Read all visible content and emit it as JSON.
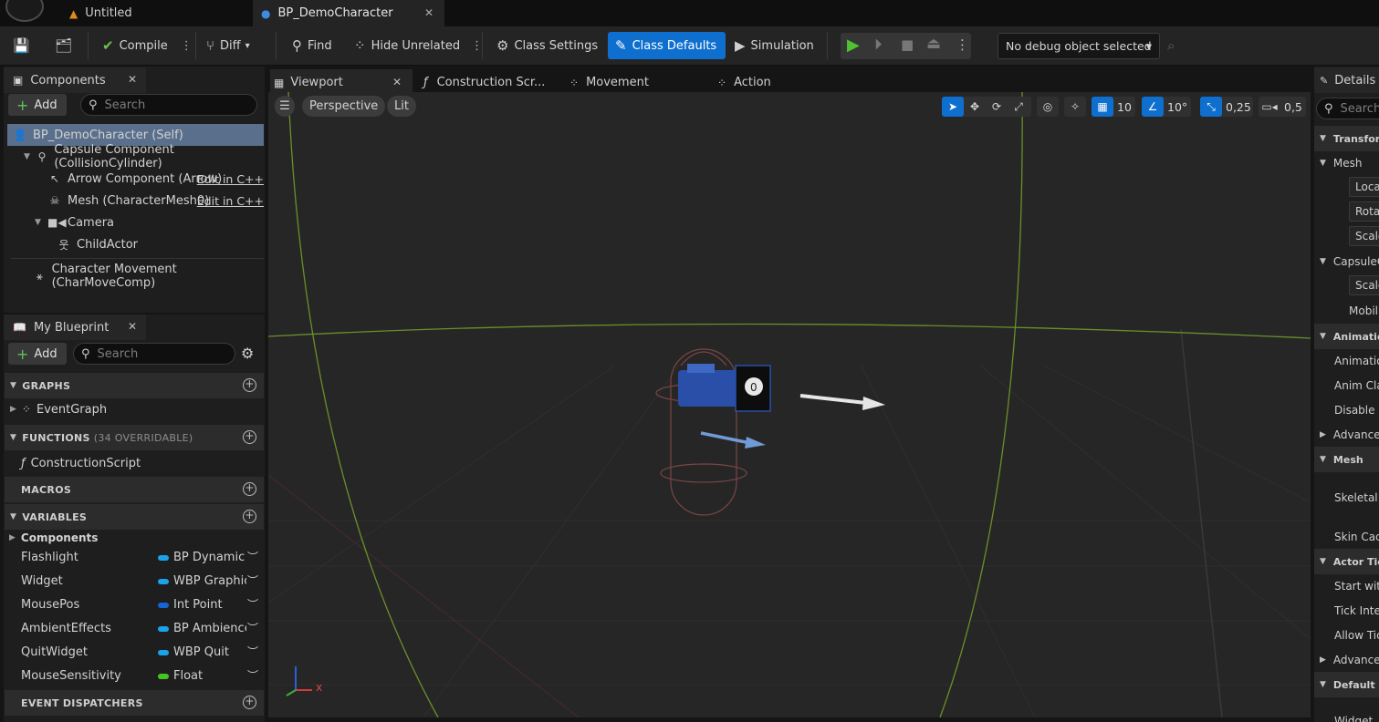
{
  "tabs": {
    "untitled": "Untitled",
    "blueprint": "BP_DemoCharacter"
  },
  "toolbar": {
    "compile": "Compile",
    "diff": "Diff",
    "find": "Find",
    "hide_unrelated": "Hide Unrelated",
    "class_settings": "Class Settings",
    "class_defaults": "Class Defaults",
    "simulation": "Simulation",
    "debug_object": "No debug object selected"
  },
  "components_panel": {
    "title": "Components",
    "add": "Add",
    "search_placeholder": "Search",
    "edit_cpp": "Edit in C++",
    "items": [
      "BP_DemoCharacter (Self)",
      "Capsule Component (CollisionCylinder)",
      "Arrow Component (Arrow)",
      "Mesh (CharacterMesh0)",
      "Camera",
      "ChildActor",
      "Character Movement (CharMoveComp)"
    ]
  },
  "my_blueprint": {
    "title": "My Blueprint",
    "add": "Add",
    "search_placeholder": "Search",
    "graphs_header": "GRAPHS",
    "event_graph": "EventGraph",
    "functions_header": "FUNCTIONS",
    "functions_overridable": "(34 OVERRIDABLE)",
    "construction_script": "ConstructionScript",
    "macros_header": "MACROS",
    "variables_header": "VARIABLES",
    "components_category": "Components",
    "variables": [
      {
        "name": "Flashlight",
        "type": "BP Dynamic",
        "color": "#1aa3e8"
      },
      {
        "name": "Widget",
        "type": "WBP Graphic",
        "color": "#1aa3e8"
      },
      {
        "name": "MousePos",
        "type": "Int Point",
        "color": "#1565d8"
      },
      {
        "name": "AmbientEffects",
        "type": "BP Ambience",
        "color": "#1aa3e8"
      },
      {
        "name": "QuitWidget",
        "type": "WBP Quit",
        "color": "#1aa3e8"
      },
      {
        "name": "MouseSensitivity",
        "type": "Float",
        "color": "#43c61d"
      }
    ],
    "event_dispatchers_header": "EVENT DISPATCHERS"
  },
  "viewport": {
    "tabs": [
      "Viewport",
      "Construction Scr...",
      "Movement",
      "Action"
    ],
    "perspective": "Perspective",
    "lit": "Lit",
    "grid_snap": "10",
    "rotation_snap": "10°",
    "scale_snap": "0,25",
    "camera_speed": "0,5",
    "axis_x": "x"
  },
  "details": {
    "title": "Details",
    "search_placeholder": "Search",
    "sections": [
      {
        "label": "Transform",
        "kind": "header"
      },
      {
        "label": "Mesh",
        "kind": "sub"
      },
      {
        "label": "Location",
        "kind": "box"
      },
      {
        "label": "Rotation",
        "kind": "box"
      },
      {
        "label": "Scale",
        "kind": "box"
      },
      {
        "label": "CapsuleComponent",
        "kind": "sub"
      },
      {
        "label": "Scale",
        "kind": "box"
      },
      {
        "label": "Mobility",
        "kind": "row"
      },
      {
        "label": "Animation",
        "kind": "header"
      },
      {
        "label": "Animation Mode",
        "kind": "row"
      },
      {
        "label": "Anim Class",
        "kind": "row"
      },
      {
        "label": "Disable Post Process",
        "kind": "row"
      },
      {
        "label": "Advanced",
        "kind": "adv"
      },
      {
        "label": "Mesh",
        "kind": "header"
      },
      {
        "label": "Skeletal Mesh",
        "kind": "row"
      },
      {
        "label": "Skin Cache",
        "kind": "row"
      },
      {
        "label": "Actor Tick",
        "kind": "header"
      },
      {
        "label": "Start with Tick Enabled",
        "kind": "row"
      },
      {
        "label": "Tick Interval",
        "kind": "row"
      },
      {
        "label": "Allow Tick Before BeginPlay",
        "kind": "row"
      },
      {
        "label": "Advanced",
        "kind": "adv"
      },
      {
        "label": "Default",
        "kind": "header"
      },
      {
        "label": "Widget",
        "kind": "row"
      }
    ]
  }
}
